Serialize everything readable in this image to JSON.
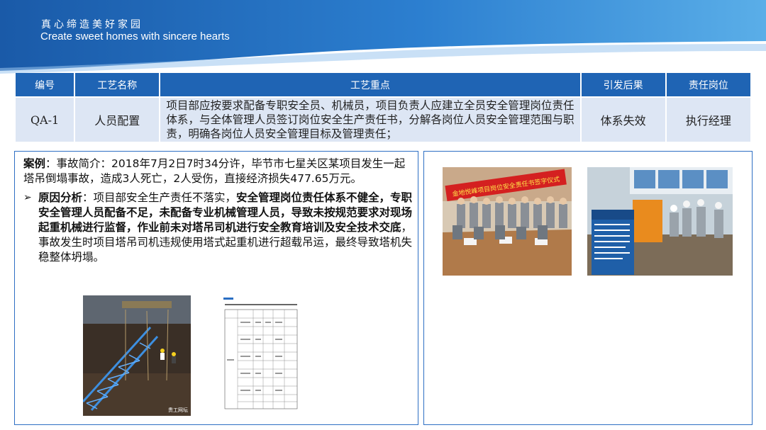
{
  "header": {
    "slogan_cn": "真心缔造美好家园",
    "slogan_en": "Create sweet homes with sincere hearts"
  },
  "table": {
    "headers": [
      "编号",
      "工艺名称",
      "工艺重点",
      "引发后果",
      "责任岗位"
    ],
    "row": {
      "id": "QA-1",
      "name": "人员配置",
      "key_points": "项目部应按要求配备专职安全员、机械员，项目负责人应建立全员安全管理岗位责任体系，与全体管理人员签订岗位安全生产责任书，分解各岗位人员安全管理范围与职责，明确各岗位人员安全管理目标及管理责任；",
      "consequence": "体系失效",
      "responsible": "执行经理"
    }
  },
  "case": {
    "label": "案例",
    "summary": "：事故简介：2018年7月2日7时34分许，毕节市七星关区某项目发生一起塔吊倒塌事故，造成3人死亡，2人受伤，直接经济损失477.65万元。",
    "cause_label": "原因分析",
    "cause_part1": "：项目部安全生产责任不落实，",
    "cause_bold": "安全管理岗位责任体系不健全，专职安全管理人员配备不足，未配备专业机械管理人员，导致未按规范要求对现场起重机械进行监督，作业前未对塔吊司机进行安全教育培训及安全技术交底",
    "cause_part2": "，事故发生时项目塔吊司机违规使用塔式起重机进行超载吊运，最终导致塔机失稳整体坍塌。"
  },
  "images": {
    "banner_text": "金地悦峰项目岗位安全责任书签字仪式",
    "crane_credit": "贵工网坛"
  },
  "colors": {
    "header_blue": "#1f64b4",
    "cell_bg": "#dde6f4",
    "panel_border": "#2e6fc4"
  }
}
